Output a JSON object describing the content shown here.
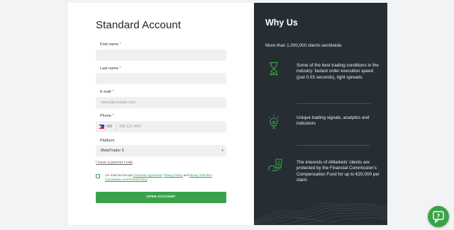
{
  "form": {
    "title": "Standard Account",
    "first_name_label": "First name",
    "last_name_label": "Last name",
    "email_label": "E-mail",
    "email_placeholder": "name@example.com",
    "phone_label": "Phone",
    "phone_code": "+63",
    "phone_placeholder": "905 123 4567",
    "platform_label": "Platform",
    "platform_value": "MetaTrader 5",
    "partner_code_link": "I have a partner code",
    "consent_prefix": "I've read and accept ",
    "consent_link1": "Customer Agreement",
    "consent_sep1": ", ",
    "consent_link2": "Privacy Policy",
    "consent_sep2": " and ",
    "consent_link3": "Wrong Transfers Cancellation and Refund Policy",
    "consent_suffix": ".",
    "submit_label": "OPEN ACCOUNT",
    "required_mark": "*"
  },
  "why": {
    "title": "Why Us",
    "subtitle": "More than 1,000,000 clients worldwide",
    "features": [
      {
        "icon": "hourglass-icon",
        "text": "Some of the best trading conditions in the industry: fastest order execution speed (just 0.03 seconds), tight spreads"
      },
      {
        "icon": "lightbulb-icon",
        "text": "Unique trading signals, analytics and indicators"
      },
      {
        "icon": "money-hand-icon",
        "text": "The interests of AMarkets' clients are protected by the Financial Commission's Compensation Fund for up to €20,000 per claim"
      }
    ]
  },
  "colors": {
    "accent": "#3aa24a",
    "dark_panel": "#262d33"
  }
}
